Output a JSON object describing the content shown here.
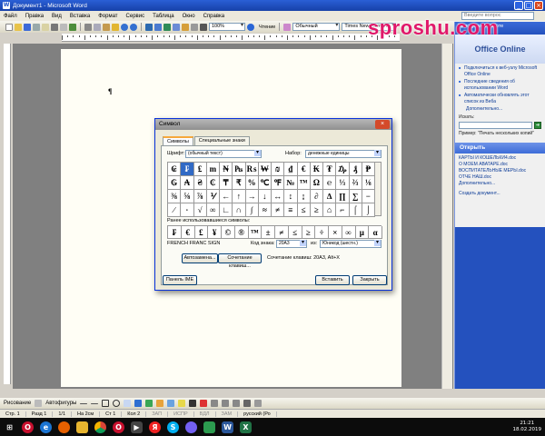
{
  "window": {
    "title": "Документ1 - Microsoft Word",
    "app_icon": "word-icon"
  },
  "menu": {
    "items": [
      "Файл",
      "Правка",
      "Вид",
      "Вставка",
      "Формат",
      "Сервис",
      "Таблица",
      "Окно",
      "Справка"
    ],
    "help_placeholder": "Введите вопрос"
  },
  "toolbar": {
    "zoom": "100%",
    "read_button": "Чтение",
    "style": "Обычный",
    "font": "Times New Roman"
  },
  "document": {
    "mark": "¶"
  },
  "taskpane": {
    "title": "Приступая к работе",
    "logo": "Office Online",
    "links": [
      "Подключиться к веб-узлу Microsoft Office Online",
      "Последние сведения об использовании Word",
      "Автоматически обновлять этот список из Веба"
    ],
    "more": "Дополнительно...",
    "search_label": "Искать:",
    "example": "Пример: \"Печать нескольких копий\"",
    "open_header": "Открыть",
    "files": [
      "КАРТЫ И КОШЕЛЬКИ4.doc",
      "О МОЕМ АВАТАРЕ.doc",
      "ВОСПИТАТЕЛЬНЫЕ МЕРЫ.doc",
      "ОТЧЕ НАШ.doc"
    ],
    "files_more": "Дополнительно...",
    "create": "Создать документ..."
  },
  "dialog": {
    "title": "Символ",
    "tabs": [
      "Символы",
      "Специальные знаки"
    ],
    "font_label": "Шрифт:",
    "font_value": "(обычный текст)",
    "subset_label": "Набор:",
    "subset_value": "денежные единицы",
    "symbols": [
      "₢",
      "₣",
      "₤",
      "m",
      "₦",
      "₧",
      "₨",
      "₩",
      "₪",
      "₫",
      "€",
      "₭",
      "₮",
      "₯",
      "₰",
      "₱",
      "₲",
      "₳",
      "₴",
      "₵",
      "₸",
      "₹",
      "%",
      "℃",
      "℉",
      "№",
      "™",
      "Ω",
      "℮",
      "⅓",
      "⅔",
      "⅛",
      "⅜",
      "⅝",
      "⅞",
      "⅟",
      "←",
      "↑",
      "→",
      "↓",
      "↔",
      "↕",
      "↨",
      "∂",
      "∆",
      "∏",
      "∑",
      "−",
      "∕",
      "∙",
      "√",
      "∞",
      "∟",
      "∩",
      "∫",
      "≈",
      "≠",
      "≡",
      "≤",
      "≥",
      "⌂",
      "⌐",
      "⌠",
      "⌡"
    ],
    "recent_label": "Ранее использовавшиеся символы:",
    "recent": [
      "₣",
      "€",
      "£",
      "¥",
      "©",
      "®",
      "™",
      "±",
      "≠",
      "≤",
      "≥",
      "÷",
      "×",
      "∞",
      "µ",
      "α"
    ],
    "char_name": "FRENCH FRANC SIGN",
    "code_label": "Код знака:",
    "code_value": "20A3",
    "from_label": "из:",
    "from_value": "Юникод (шестн.)",
    "autocorrect": "Автозамена...",
    "shortcut_key": "Сочетание клавиш...",
    "shortcut_text": "Сочетание клавиш: 20A3, Alt+X",
    "ime": "Панель IME",
    "insert": "Вставить",
    "close": "Закрыть"
  },
  "drawing": {
    "label": "Рисование",
    "autoshapes": "Автофигуры"
  },
  "status": {
    "page": "Стр. 1",
    "section": "Разд 1",
    "pages": "1/1",
    "at": "На 2см",
    "line": "Ст 1",
    "col": "Кол 2",
    "modes": [
      "ЗАП",
      "ИСПР",
      "ВДЛ",
      "ЗАМ"
    ],
    "lang": "русский (Ро"
  },
  "taskbar": {
    "icons": [
      "start-icon",
      "opera-icon",
      "ie-icon",
      "firefox-icon",
      "explorer-icon",
      "chrome-icon",
      "opera-icon",
      "media-icon",
      "yandex-icon",
      "skype-icon",
      "viber-icon",
      "photo-icon",
      "word-icon",
      "excel-icon"
    ],
    "time": "21:21",
    "date": "18.02.2019"
  },
  "watermark": "sproshu.com"
}
